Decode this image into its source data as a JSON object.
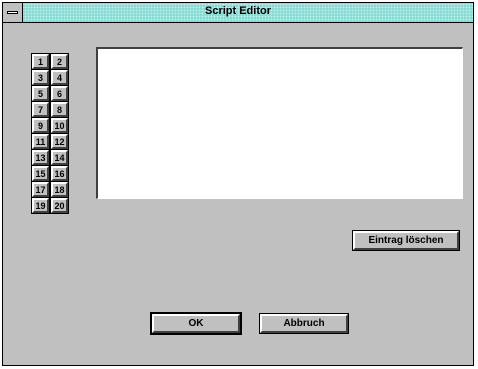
{
  "window": {
    "title": "Script Editor"
  },
  "slots": [
    "1",
    "2",
    "3",
    "4",
    "5",
    "6",
    "7",
    "8",
    "9",
    "10",
    "11",
    "12",
    "13",
    "14",
    "15",
    "16",
    "17",
    "18",
    "19",
    "20"
  ],
  "editor": {
    "value": ""
  },
  "buttons": {
    "delete_entry": "Eintrag löschen",
    "ok": "OK",
    "cancel": "Abbruch"
  }
}
